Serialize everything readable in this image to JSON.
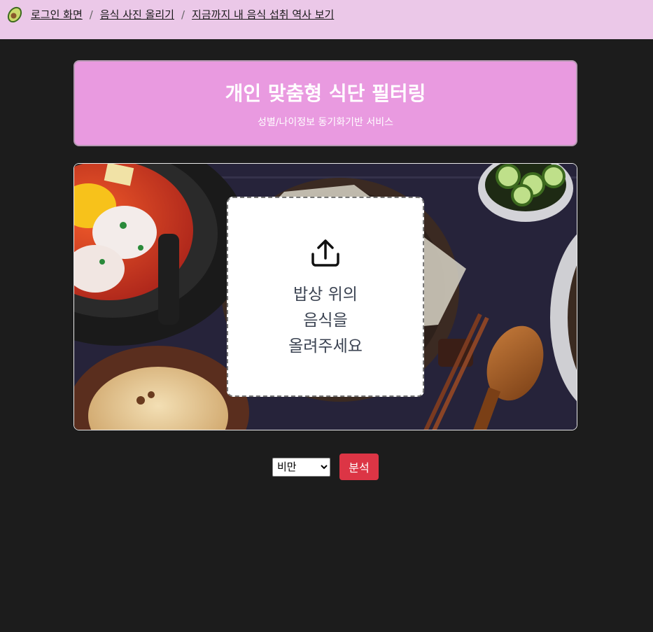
{
  "nav": {
    "logo_icon": "avocado-icon",
    "links": [
      {
        "label": "로그인 화면"
      },
      {
        "label": "음식 사진 올리기"
      },
      {
        "label": "지금까지 내 음식 섭취 역사 보기"
      }
    ],
    "separator": "/"
  },
  "banner": {
    "title": "개인 맞춤형 식단 필터링",
    "subtitle": "성별/나이정보 동기화기반 서비스"
  },
  "upload": {
    "icon": "upload-icon",
    "lines": [
      "밥상 위의",
      "음식을",
      "올려주세요"
    ]
  },
  "controls": {
    "selected_option": "비만",
    "analyze_label": "분석"
  },
  "colors": {
    "nav_bg": "#ebc8e8",
    "banner_bg": "#e99ae0",
    "page_bg": "#1c1c1c",
    "button_bg": "#dc3545"
  }
}
